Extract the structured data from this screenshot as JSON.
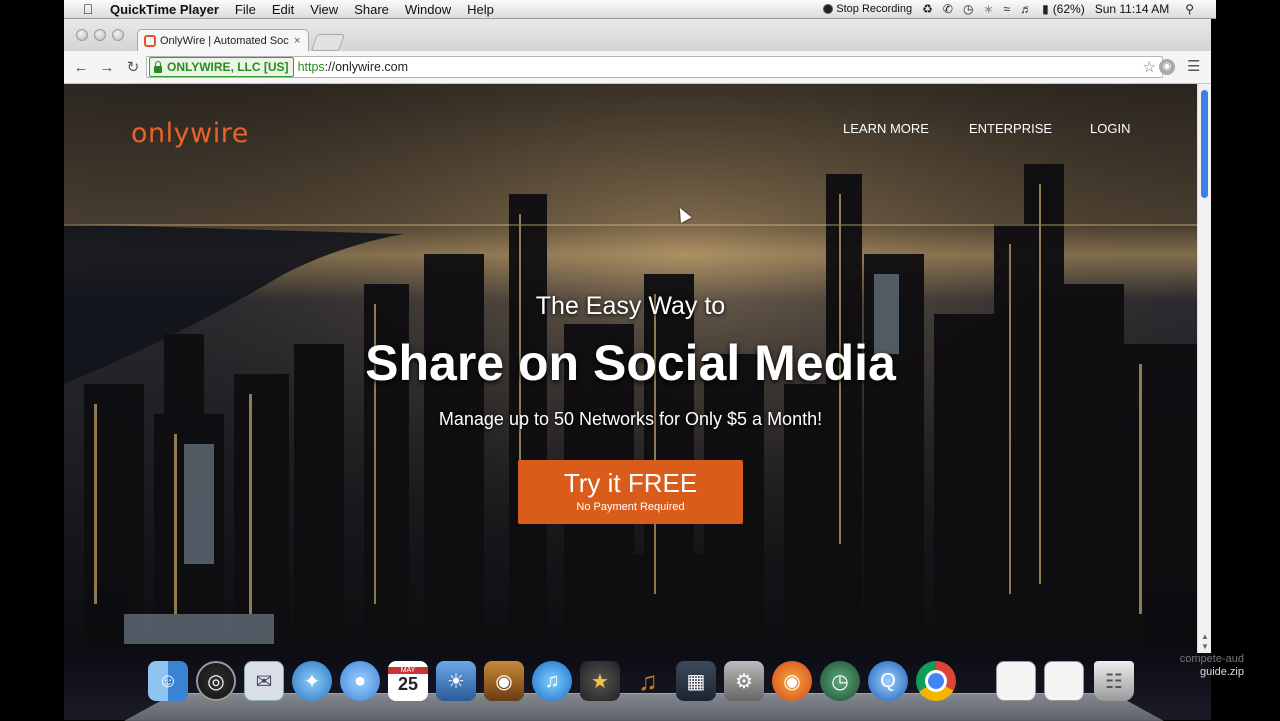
{
  "menubar": {
    "app_name": "QuickTime Player",
    "menus": [
      "File",
      "Edit",
      "View",
      "Share",
      "Window",
      "Help"
    ],
    "stop_recording": "Stop Recording",
    "battery": "(62%)",
    "clock": "Sun 11:14 AM"
  },
  "browser": {
    "tab_title": "OnlyWire | Automated Soc",
    "tab_close": "×",
    "ev_org": "ONLYWIRE, LLC [US]",
    "url_scheme": "https",
    "url_rest": "://onlywire.com"
  },
  "page": {
    "logo": "onlywire",
    "nav": [
      "LEARN MORE",
      "ENTERPRISE",
      "LOGIN"
    ],
    "hero_sub": "The Easy Way to",
    "hero_title": "Share on Social Media",
    "hero_tag": "Manage up to 50 Networks for Only $5 a Month!",
    "cta_main": "Try it FREE",
    "cta_sub": "No Payment Required"
  },
  "dock": {
    "calendar_month": "MAY",
    "calendar_day": "25",
    "file_label_partial": "compete-aud",
    "file_label": "guide.zip",
    "icons": [
      "finder-icon",
      "dashboard-icon",
      "mail-icon",
      "safari-icon",
      "facetime-icon",
      "calendar-icon",
      "iphoto-icon",
      "photo-booth-icon",
      "itunes-icon",
      "imovie-icon",
      "garageband-icon",
      "mission-control-icon",
      "system-preferences-icon",
      "firefox-icon",
      "time-machine-icon",
      "quicktime-icon",
      "chrome-icon",
      "document-icon",
      "document-icon",
      "trash-icon"
    ]
  }
}
